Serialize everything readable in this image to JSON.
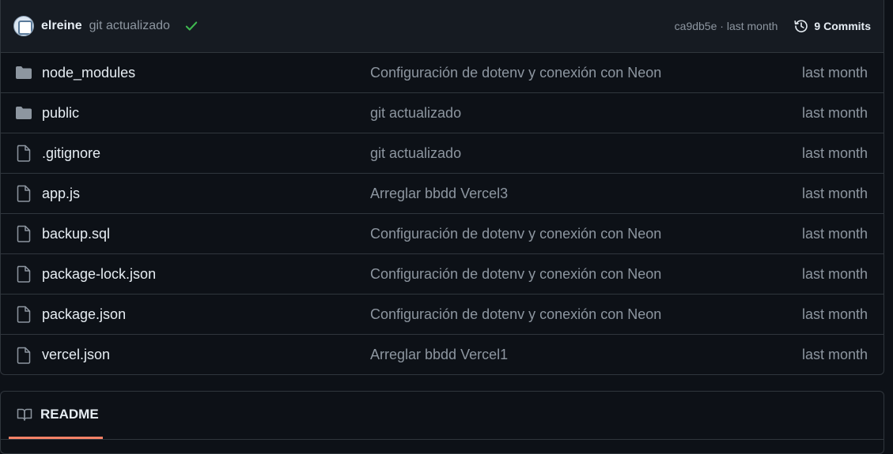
{
  "latest_commit": {
    "author": "elreine",
    "message": "git actualizado",
    "status_icon": "check-icon",
    "hash": "ca9db5e",
    "separator": "·",
    "time": "last month",
    "commits_label": "9 Commits"
  },
  "files": [
    {
      "type": "folder",
      "name": "node_modules",
      "commit": "Configuración de dotenv y conexión con Neon",
      "date": "last month"
    },
    {
      "type": "folder",
      "name": "public",
      "commit": "git actualizado",
      "date": "last month"
    },
    {
      "type": "file",
      "name": ".gitignore",
      "commit": "git actualizado",
      "date": "last month"
    },
    {
      "type": "file",
      "name": "app.js",
      "commit": "Arreglar bbdd Vercel3",
      "date": "last month"
    },
    {
      "type": "file",
      "name": "backup.sql",
      "commit": "Configuración de dotenv y conexión con Neon",
      "date": "last month"
    },
    {
      "type": "file",
      "name": "package-lock.json",
      "commit": "Configuración de dotenv y conexión con Neon",
      "date": "last month"
    },
    {
      "type": "file",
      "name": "package.json",
      "commit": "Configuración de dotenv y conexión con Neon",
      "date": "last month"
    },
    {
      "type": "file",
      "name": "vercel.json",
      "commit": "Arreglar bbdd Vercel1",
      "date": "last month"
    }
  ],
  "readme": {
    "tab_label": "README",
    "icon": "book-icon"
  },
  "colors": {
    "background": "#0d1117",
    "header_bg": "#161b22",
    "border": "#30363d",
    "muted_text": "#8d96a0",
    "text": "#e6edf3",
    "success": "#3fb950",
    "tab_underline": "#f78166",
    "folder_icon": "#8d96a0"
  }
}
